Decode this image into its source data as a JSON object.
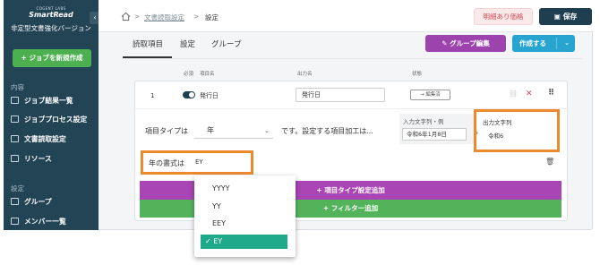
{
  "sidebar": {
    "brand_top": "COGENT LABS",
    "brand": "SmartRead",
    "brand_sub": "非定型文書強化バージョン",
    "collapse": "‹",
    "new_job": "+ ジョブを新規作成",
    "section1": "内容",
    "items1": [
      {
        "label": "ジョブ結果一覧",
        "icon": "list-icon"
      },
      {
        "label": "ジョブプロセス設定",
        "icon": "settings-list-icon"
      },
      {
        "label": "文書読取設定",
        "icon": "document-icon"
      },
      {
        "label": "リソース",
        "icon": "resource-icon"
      }
    ],
    "section2": "設定",
    "items2": [
      {
        "label": "グループ",
        "icon": "group-icon"
      },
      {
        "label": "メンバー一覧",
        "icon": "member-icon"
      }
    ]
  },
  "topbar": {
    "breadcrumb": [
      ">",
      "文書読取設定",
      ">",
      "設定"
    ],
    "price_button": "明細あり価格",
    "save_button": "保存"
  },
  "tabs": [
    "読取項目",
    "設定",
    "グループ"
  ],
  "actions": {
    "group_edit": "グループ編集",
    "create": "作成する",
    "create_caret": "⌄"
  },
  "columns": [
    "必須",
    "項目名",
    "出力名",
    "状態"
  ],
  "item": {
    "index": "1",
    "name": "発行日",
    "output_name": "発行日",
    "status": "→ 編集済",
    "type_label": "項目タイプは",
    "type_value": "年",
    "type_suffix": "です。設定する項目加工は...",
    "input_example_label": "入力文字列・例",
    "input_example_value": "令和6年1月8日",
    "output_label": "出力文字列",
    "output_value": "令和6",
    "year_format_label": "年の書式は",
    "year_format_value": "EY",
    "add_type_setting": "+ 項目タイプ設定追加",
    "add_filter": "+ フィルター追加"
  },
  "dropdown": {
    "options": [
      "YYYY",
      "YY",
      "EEY"
    ],
    "selected": "✓ EY"
  },
  "colors": {
    "sidebar": "#234455",
    "accent_orange": "#ec8a2e",
    "purple": "#a945b4",
    "green": "#53b35b",
    "teal": "#1faa8b"
  }
}
